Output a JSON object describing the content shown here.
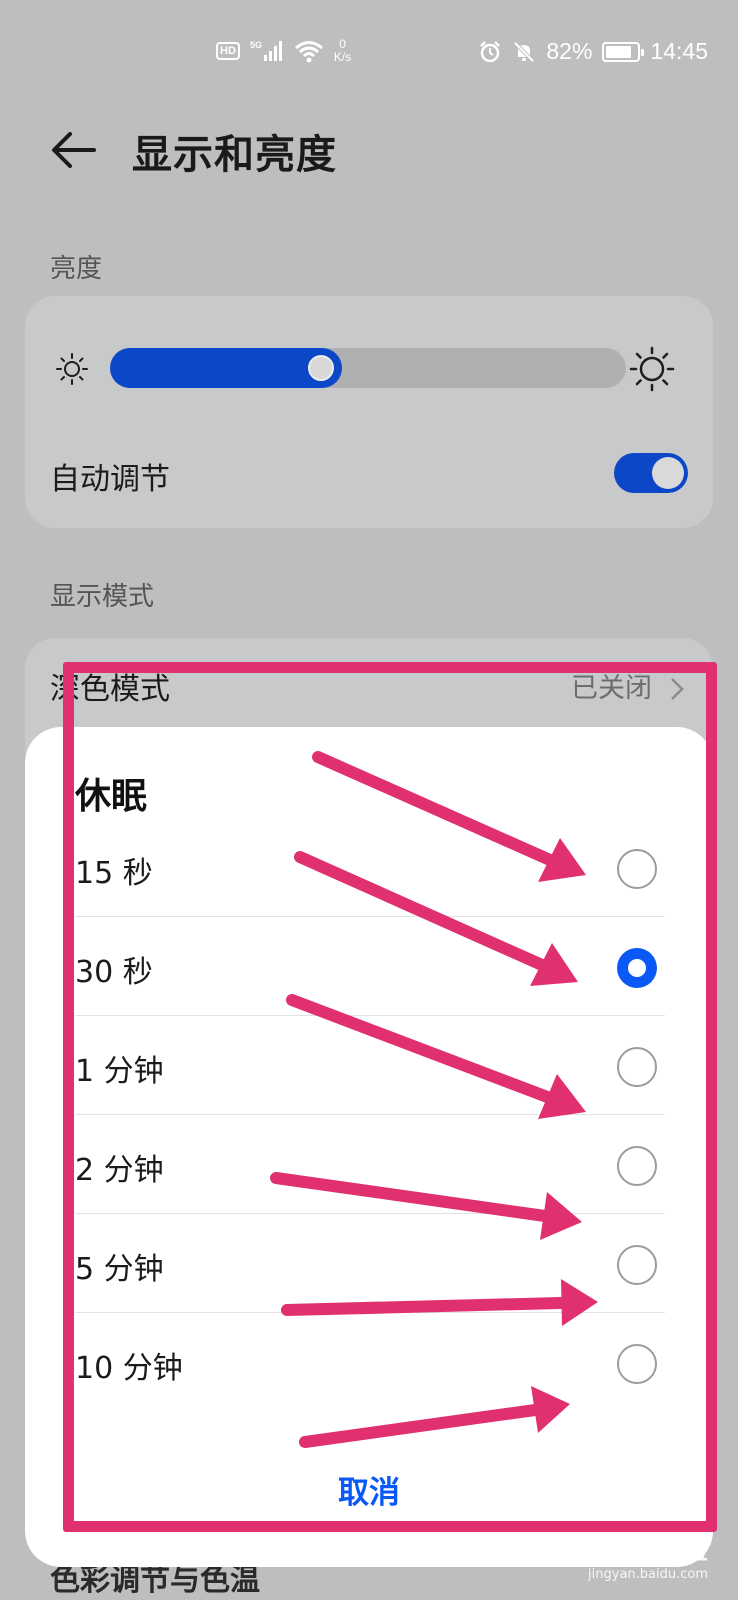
{
  "status_bar": {
    "hd_label": "HD",
    "network_label": "5G",
    "speed_value": "0",
    "speed_unit": "K/s",
    "battery_text": "82%",
    "battery_level": 0.82,
    "time": "14:45"
  },
  "header": {
    "title": "显示和亮度"
  },
  "brightness": {
    "section_label": "亮度",
    "level": 0.45,
    "auto_label": "自动调节",
    "auto_on": true
  },
  "display_mode": {
    "section_label": "显示模式",
    "dark_mode_label": "深色模式",
    "dark_mode_value": "已关闭"
  },
  "sleep_dialog": {
    "title": "休眠",
    "options": [
      {
        "label": "15 秒",
        "selected": false
      },
      {
        "label": "30 秒",
        "selected": true
      },
      {
        "label": "1 分钟",
        "selected": false
      },
      {
        "label": "2 分钟",
        "selected": false
      },
      {
        "label": "5 分钟",
        "selected": false
      },
      {
        "label": "10 分钟",
        "selected": false
      }
    ],
    "cancel_label": "取消"
  },
  "underlying_partial_text": "色彩调节与色温",
  "colors": {
    "accent": "#0a59f7",
    "slider_fill": "#0b47c7",
    "annotation": "#e1306f",
    "backdrop": "#bdbebf"
  },
  "watermark": {
    "main": "Baidu经验",
    "sub": "jingyan.baidu.com"
  }
}
